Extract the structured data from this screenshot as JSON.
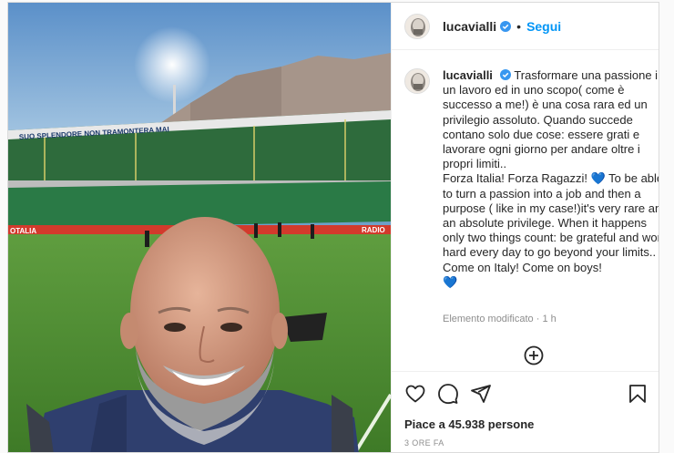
{
  "post": {
    "username": "lucavialli",
    "follow_label": "Segui",
    "separator": "•",
    "more_icon": "more-icon",
    "verified_color": "#3897f0",
    "follow_color": "#0095f6"
  },
  "caption": {
    "username": "lucavialli",
    "it_text": "Trasformare una passione in un lavoro ed in uno scopo( come è successo a me!) è una cosa rara ed un privilegio assoluto. Quando succede contano solo due cose: essere grati e lavorare ogni giorno per andare oltre i propri limiti..",
    "it_cheer": "Forza Italia! Forza Ragazzi!",
    "heart": "💙",
    "en_text": "To be able to turn a passion into a job and then a purpose ( like in my case!)it's very rare and an absolute privilege. When it happens only two things count: be grateful and work hard every day to go beyond your limits..",
    "en_cheer": "Come on Italy! Come on boys!",
    "heart2": "💙"
  },
  "meta": {
    "edited": "Elemento modificato",
    "dot": "·",
    "age": "1 h"
  },
  "photo": {
    "banner_text": "SUO SPLENDORE NON TRAMONTERA MAI",
    "ad_left": "OTALIA",
    "ad_right": "RADIO"
  },
  "likes": {
    "text": "Piace a 45.938 persone"
  },
  "timestamp": "3 ORE FA",
  "icons": [
    "like-icon",
    "comment-icon",
    "share-icon",
    "save-icon",
    "add-comment-icon"
  ]
}
